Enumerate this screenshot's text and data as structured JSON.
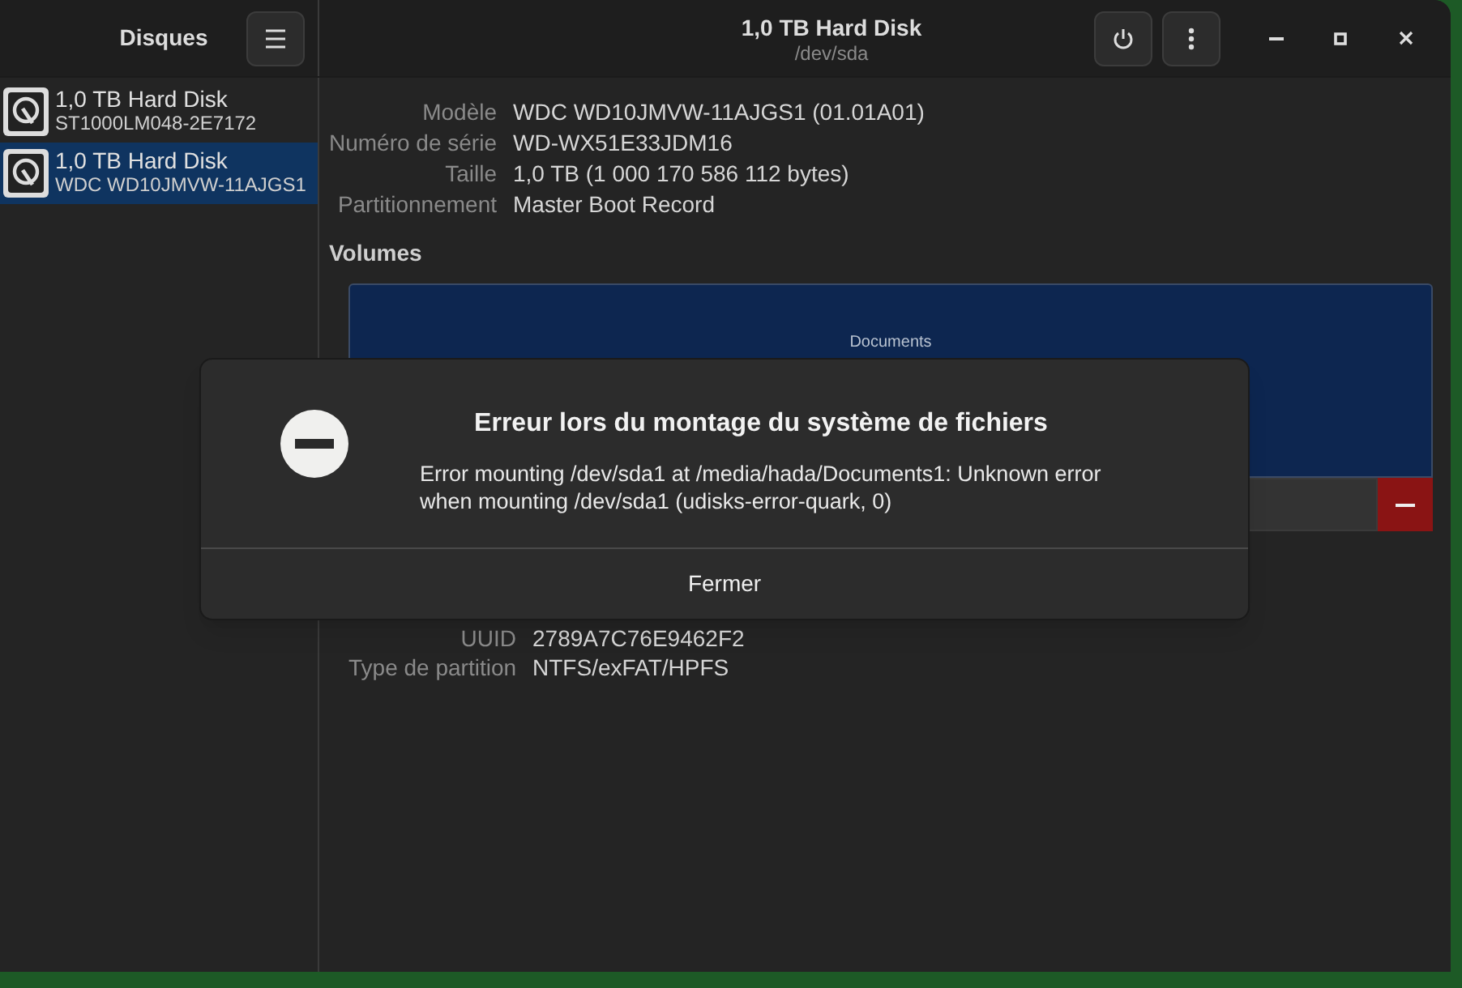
{
  "sidebar": {
    "title": "Disques",
    "items": [
      {
        "name": "1,0 TB Hard Disk",
        "model": "ST1000LM048-2E7172",
        "selected": false
      },
      {
        "name": "1,0 TB Hard Disk",
        "model": "WDC WD10JMVW-11AJGS1",
        "selected": true
      }
    ]
  },
  "header": {
    "title": "1,0 TB Hard Disk",
    "subtitle": "/dev/sda"
  },
  "disk_info": [
    {
      "label": "Modèle",
      "value": "WDC WD10JMVW-11AJGS1 (01.01A01)"
    },
    {
      "label": "Numéro de série",
      "value": "WD-WX51E33JDM16"
    },
    {
      "label": "Taille",
      "value": "1,0 TB (1 000 170 586 112 bytes)"
    },
    {
      "label": "Partitionnement",
      "value": "Master Boot Record"
    }
  ],
  "volumes": {
    "title": "Volumes",
    "partitions": [
      {
        "label": "Documents",
        "selected": true
      }
    ]
  },
  "partition_info": [
    {
      "label": "UUID",
      "value": "2789A7C76E9462F2"
    },
    {
      "label": "Type de partition",
      "value": "NTFS/exFAT/HPFS"
    }
  ],
  "dialog": {
    "title": "Erreur lors du montage du système de fichiers",
    "message": "Error mounting /dev/sda1 at /media/hada/Documents1: Unknown error when mounting /dev/sda1 (udisks-error-quark, 0)",
    "button": "Fermer"
  }
}
